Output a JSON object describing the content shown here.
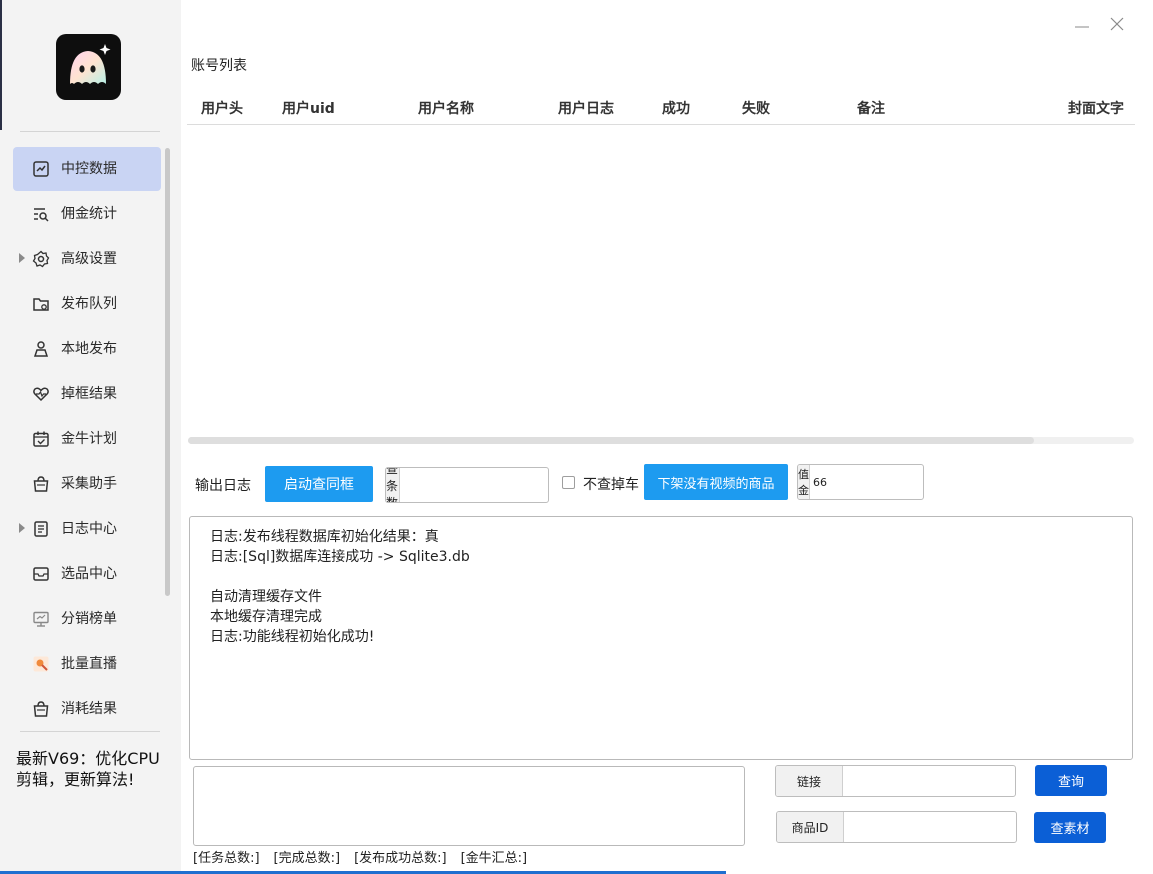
{
  "window": {
    "minimize_icon": "minimize-icon",
    "close_icon": "close-icon"
  },
  "sidebar": {
    "items": [
      {
        "label": "中控数据",
        "icon": "chart-line-icon",
        "active": true,
        "expandable": false
      },
      {
        "label": "佣金统计",
        "icon": "list-search-icon",
        "active": false,
        "expandable": false
      },
      {
        "label": "高级设置",
        "icon": "gear-icon",
        "active": false,
        "expandable": true
      },
      {
        "label": "发布队列",
        "icon": "folder-queue-icon",
        "active": false,
        "expandable": false
      },
      {
        "label": "本地发布",
        "icon": "user-stage-icon",
        "active": false,
        "expandable": false
      },
      {
        "label": "掉框结果",
        "icon": "heart-pulse-icon",
        "active": false,
        "expandable": false
      },
      {
        "label": "金牛计划",
        "icon": "calendar-check-icon",
        "active": false,
        "expandable": false
      },
      {
        "label": "采集助手",
        "icon": "shopping-bag-icon",
        "active": false,
        "expandable": false
      },
      {
        "label": "日志中心",
        "icon": "document-list-icon",
        "active": false,
        "expandable": true
      },
      {
        "label": "选品中心",
        "icon": "inbox-icon",
        "active": false,
        "expandable": false
      },
      {
        "label": "分销榜单",
        "icon": "presentation-icon",
        "active": false,
        "expandable": false
      },
      {
        "label": "批量直播",
        "icon": "live-stream-icon",
        "active": false,
        "expandable": false
      },
      {
        "label": "消耗结果",
        "icon": "shopping-bag-icon",
        "active": false,
        "expandable": false
      }
    ],
    "note_line1": "最新V69：优化CPU",
    "note_line2": "剪辑，更新算法!"
  },
  "accounts": {
    "title": "账号列表",
    "columns": [
      "用户头",
      "用户uid",
      "用户名称",
      "用户日志",
      "成功",
      "失败",
      "备注",
      "封面文字"
    ]
  },
  "toolbar": {
    "log_label": "输出日志",
    "start_button": "启动查同框",
    "count_prefix": "查条数",
    "count_value": "",
    "no_drop_label": "不查掉车",
    "no_drop_checked": false,
    "delist_button": "下架没有视频的商品",
    "recharge_prefix": "充值金额",
    "recharge_value": "66"
  },
  "log_lines": [
    "日志:发布线程数据库初始化结果：真",
    "日志:[Sql]数据库连接成功 -> Sqlite3.db",
    "",
    "自动清理缓存文件",
    "本地缓存清理完成",
    "日志:功能线程初始化成功!"
  ],
  "query": {
    "link_prefix": "链接",
    "link_value": "",
    "query_button": "查询",
    "product_prefix": "商品ID",
    "product_value": "",
    "material_button": "查素材"
  },
  "stats": [
    "[任务总数:]",
    "[完成总数:]",
    "[发布成功总数:]",
    "[金牛汇总:]"
  ],
  "colors": {
    "accent": "#1d9bf0",
    "accent_dark": "#0b5fd6",
    "nav_active": "#c9d4f3"
  }
}
